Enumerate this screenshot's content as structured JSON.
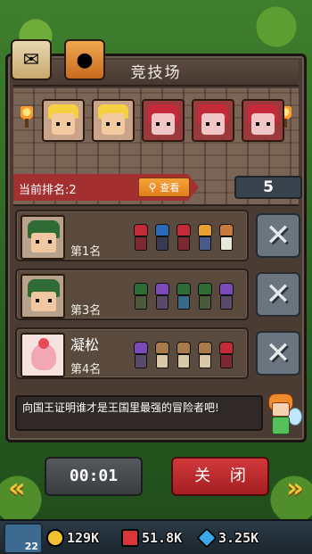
{
  "title": "竞技场",
  "rank": {
    "label": "当前排名:2",
    "view_label": "查看",
    "score": "5"
  },
  "opponents": [
    {
      "name": "",
      "rank": "第1名",
      "avatar": "green-hair-hero"
    },
    {
      "name": "",
      "rank": "第3名",
      "avatar": "green-hair-hero"
    },
    {
      "name": "凝松",
      "rank": "第4名",
      "avatar": "photo"
    }
  ],
  "message": "向国王证明谁才是王国里最强的冒险者吧!",
  "buttons": {
    "timer": "00:01",
    "close": "关 闭"
  },
  "resources": {
    "level": "22",
    "gold": "129K",
    "trophy": "51.8K",
    "gems": "3.25K"
  },
  "icons": [
    "mail-icon",
    "bag-icon",
    "search-icon",
    "crossed-swords-icon",
    "gold-coin-icon",
    "trophy-icon",
    "gem-icon"
  ],
  "colors": {
    "rank_bar": "#a33030",
    "view_button": "#f29230",
    "close_button": "#c02a2d",
    "score_box": "#39434d"
  }
}
